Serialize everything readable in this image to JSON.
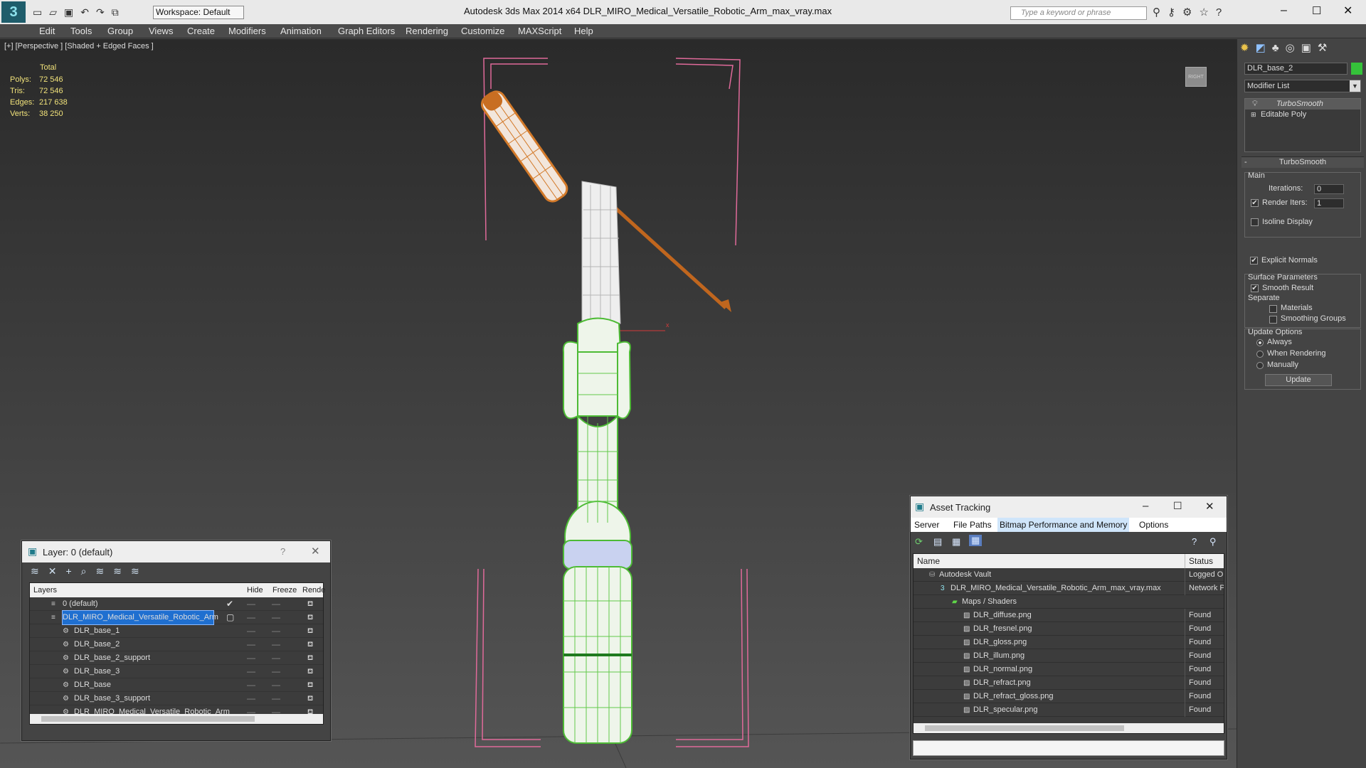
{
  "window_title": "Autodesk 3ds Max  2014 x64      DLR_MIRO_Medical_Versatile_Robotic_Arm_max_vray.max",
  "workspace": "Workspace: Default",
  "search_placeholder": "Type a keyword or phrase",
  "menu": [
    "Edit",
    "Tools",
    "Group",
    "Views",
    "Create",
    "Modifiers",
    "Animation",
    "Graph Editors",
    "Rendering",
    "Customize",
    "MAXScript",
    "Help"
  ],
  "viewport": {
    "label": "[+] [Perspective ] [Shaded + Edged Faces ]",
    "stats_header": "Total",
    "stats": [
      {
        "label": "Polys:",
        "value": "72 546"
      },
      {
        "label": "Tris:",
        "value": "72 546"
      },
      {
        "label": "Edges:",
        "value": "217 638"
      },
      {
        "label": "Verts:",
        "value": "38 250"
      }
    ],
    "viewcube_label": "RIGHT",
    "accent_green": "#5fd648",
    "accent_orange": "#d37a2a",
    "bbox_pink": "#e06a9a"
  },
  "command_panel": {
    "object_name": "DLR_base_2",
    "object_color": "#35c23a",
    "modifier_list": "Modifier List",
    "stack": [
      "TurboSmooth",
      "Editable Poly"
    ],
    "rollout_title": "TurboSmooth",
    "main_label": "Main",
    "iterations_label": "Iterations:",
    "iterations_value": "0",
    "render_iters_label": "Render Iters:",
    "render_iters_value": "1",
    "isoline": "Isoline Display",
    "explicit_normals": "Explicit Normals",
    "surface_params": "Surface Parameters",
    "smooth_result": "Smooth Result",
    "separate": "Separate",
    "materials": "Materials",
    "smoothing_groups": "Smoothing Groups",
    "update_options": "Update Options",
    "always": "Always",
    "when_rendering": "When Rendering",
    "manually": "Manually",
    "update_button": "Update"
  },
  "layer_window": {
    "title": "Layer: 0 (default)",
    "help": "?",
    "columns": [
      "Layers",
      "Hide",
      "Freeze",
      "Rende"
    ],
    "rows": [
      {
        "name": "0 (default)",
        "indent": 1,
        "selected": false,
        "check": "✔"
      },
      {
        "name": "DLR_MIRO_Medical_Versatile_Robotic_Arm",
        "indent": 1,
        "selected": true,
        "check": "▢"
      },
      {
        "name": "DLR_base_1",
        "indent": 2,
        "selected": false,
        "check": ""
      },
      {
        "name": "DLR_base_2",
        "indent": 2,
        "selected": false,
        "check": ""
      },
      {
        "name": "DLR_base_2_support",
        "indent": 2,
        "selected": false,
        "check": ""
      },
      {
        "name": "DLR_base_3",
        "indent": 2,
        "selected": false,
        "check": ""
      },
      {
        "name": "DLR_base",
        "indent": 2,
        "selected": false,
        "check": ""
      },
      {
        "name": "DLR_base_3_support",
        "indent": 2,
        "selected": false,
        "check": ""
      },
      {
        "name": "DLR_MIRO_Medical_Versatile_Robotic_Arm",
        "indent": 2,
        "selected": false,
        "check": ""
      }
    ]
  },
  "asset_window": {
    "title": "Asset Tracking",
    "menu": [
      "Server",
      "File",
      "Paths",
      "Bitmap Performance and Memory",
      "Options"
    ],
    "columns": [
      "Name",
      "Status"
    ],
    "rows": [
      {
        "name": "Autodesk Vault",
        "status": "Logged Ou",
        "indent": 1
      },
      {
        "name": "DLR_MIRO_Medical_Versatile_Robotic_Arm_max_vray.max",
        "status": "Network P",
        "indent": 2
      },
      {
        "name": "Maps / Shaders",
        "status": "",
        "indent": 3
      },
      {
        "name": "DLR_diffuse.png",
        "status": "Found",
        "indent": 4
      },
      {
        "name": "DLR_fresnel.png",
        "status": "Found",
        "indent": 4
      },
      {
        "name": "DLR_gloss.png",
        "status": "Found",
        "indent": 4
      },
      {
        "name": "DLR_illum.png",
        "status": "Found",
        "indent": 4
      },
      {
        "name": "DLR_normal.png",
        "status": "Found",
        "indent": 4
      },
      {
        "name": "DLR_refract.png",
        "status": "Found",
        "indent": 4
      },
      {
        "name": "DLR_refract_gloss.png",
        "status": "Found",
        "indent": 4
      },
      {
        "name": "DLR_specular.png",
        "status": "Found",
        "indent": 4
      }
    ]
  }
}
